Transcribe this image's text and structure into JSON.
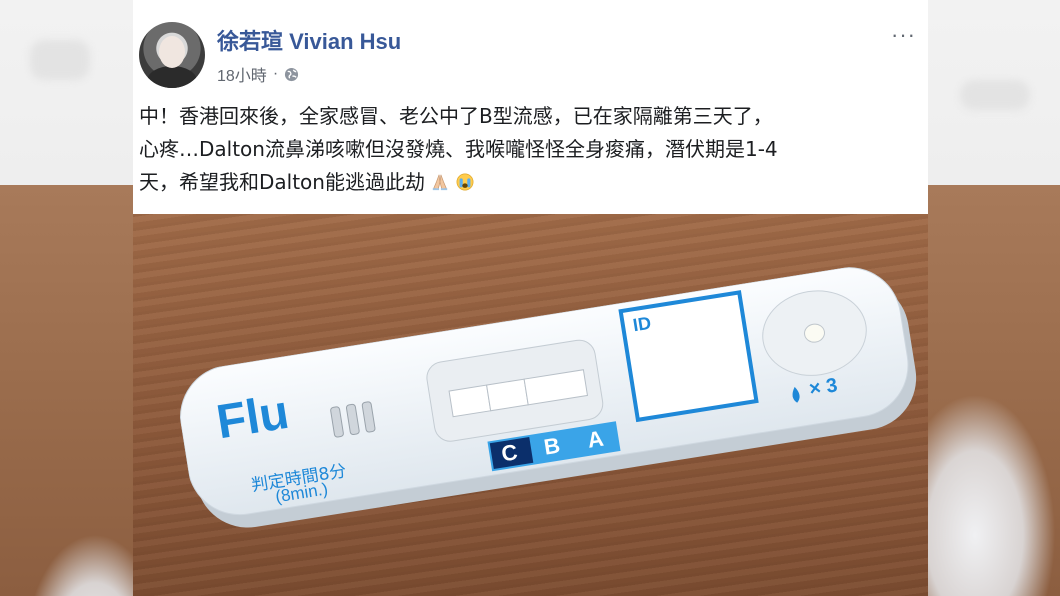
{
  "post": {
    "author": "徐若瑄 Vivian Hsu",
    "time": "18小時",
    "separator": "·",
    "more": "···",
    "text_line1": "中！香港回來後，全家感冒、老公中了B型流感，已在家隔離第三天了，",
    "text_line2": "心疼…Dalton流鼻涕咳嗽但沒發燒、我喉嚨怪怪全身痠痛，潛伏期是1-4",
    "text_line3": "天，希望我和Dalton能逃過此劫"
  },
  "photo": {
    "brand": "Flu",
    "id_label": "ID",
    "wells": [
      "C",
      "B",
      "A"
    ],
    "drops": "× 3",
    "time_label": "判定時間8分",
    "time_label_en": "(8min.)"
  },
  "colors": {
    "link": "#385898",
    "accent": "#1e88d8",
    "text": "#1c1e21",
    "meta": "#616770"
  },
  "icons": [
    "globe-icon",
    "more-options-icon",
    "praying-hands-icon",
    "crying-face-icon",
    "drop-icon"
  ]
}
